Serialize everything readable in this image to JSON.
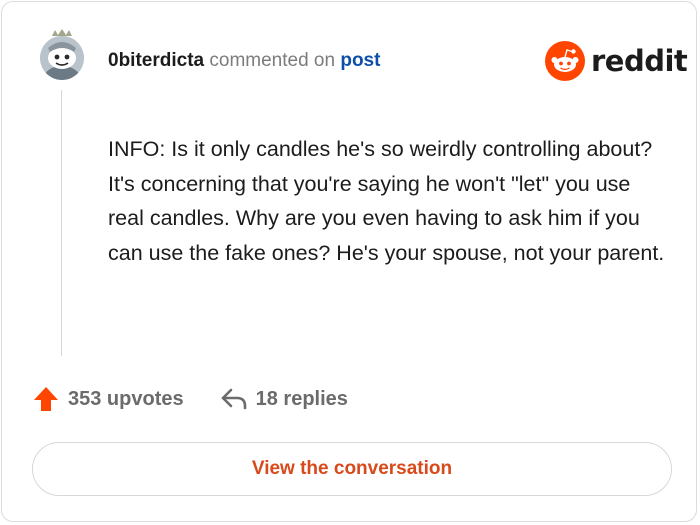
{
  "comment": {
    "username": "0biterdicta",
    "action_text": "commented on",
    "link_text": "post",
    "body": "INFO: Is it only candles he's so weirdly controlling about? It's concerning that you're saying he won't \"let\" you use real candles. Why are you even having to ask him if you can use the fake ones? He's your spouse, not your parent."
  },
  "brand": {
    "name": "reddit",
    "accent_color": "#ff4500"
  },
  "stats": {
    "upvotes_label": "353 upvotes",
    "replies_label": "18 replies"
  },
  "cta": {
    "label": "View the conversation"
  },
  "icons": {
    "upvote": "upvote-arrow-icon",
    "replies": "reply-arrow-icon",
    "logo": "reddit-snoo-icon"
  }
}
